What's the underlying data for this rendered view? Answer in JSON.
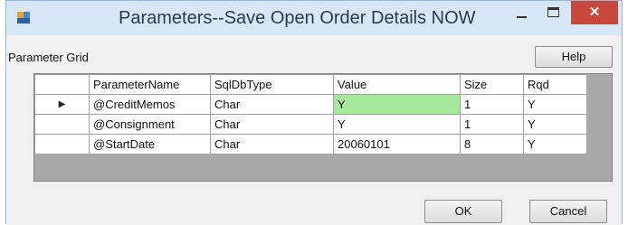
{
  "window": {
    "title": "Parameters--Save Open Order Details NOW",
    "minimize_glyph": "—",
    "close_glyph": "✕"
  },
  "grid": {
    "label": "Parameter Grid",
    "columns": [
      "ParameterName",
      "SqlDbType",
      "Value",
      "Size",
      "Rqd"
    ],
    "rows": [
      {
        "name": "@CreditMemos",
        "type": "Char",
        "value": "Y",
        "size": "1",
        "rqd": "Y"
      },
      {
        "name": "@Consignment",
        "type": "Char",
        "value": "Y",
        "size": "1",
        "rqd": "Y"
      },
      {
        "name": "@StartDate",
        "type": "Char",
        "value": "20060101",
        "size": "8",
        "rqd": "Y"
      }
    ],
    "current_row_glyph": "▶",
    "highlight_color": "#a6e89a"
  },
  "buttons": {
    "help": "Help",
    "ok": "OK",
    "cancel": "Cancel"
  }
}
